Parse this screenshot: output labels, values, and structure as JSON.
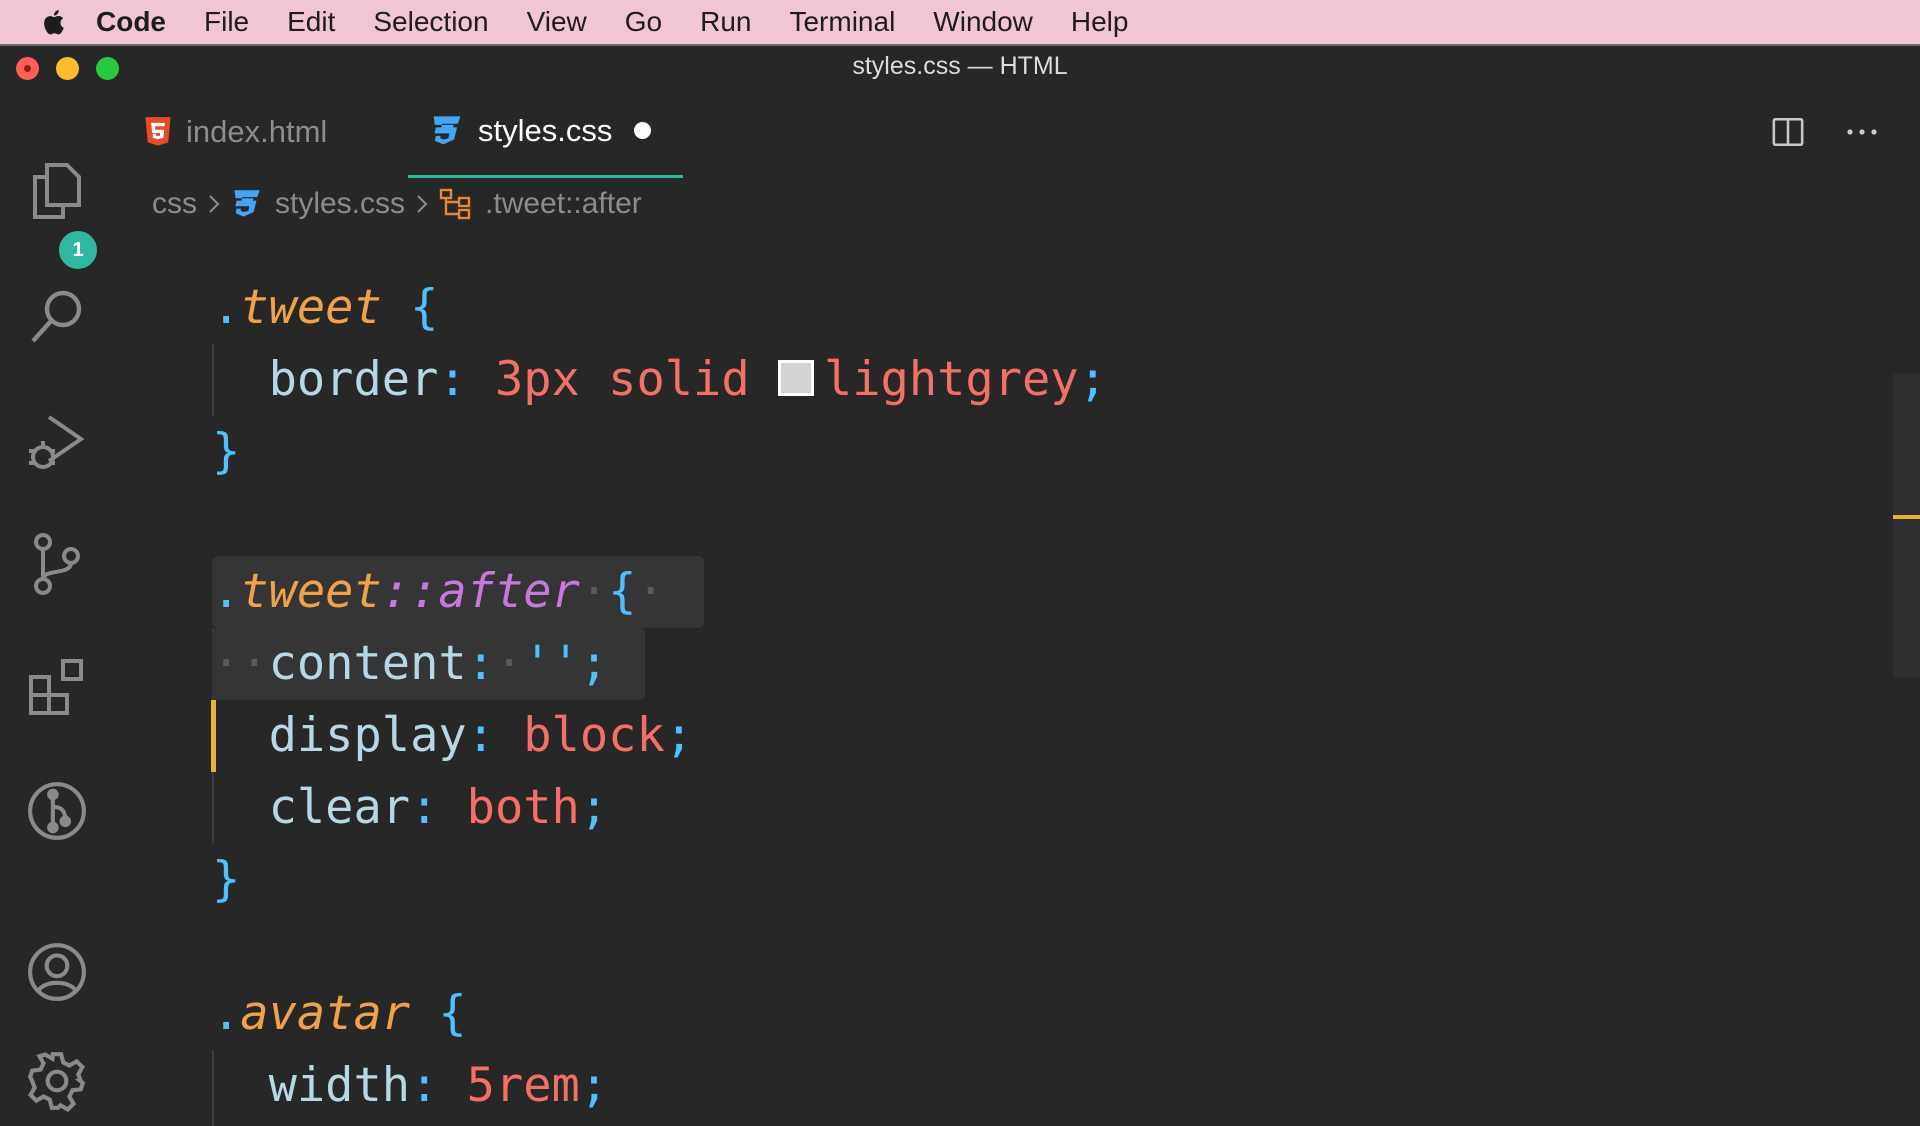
{
  "menubar": {
    "app_name": "Code",
    "items": [
      "File",
      "Edit",
      "Selection",
      "View",
      "Go",
      "Run",
      "Terminal",
      "Window",
      "Help"
    ]
  },
  "window": {
    "title": "styles.css — HTML"
  },
  "activity_bar": {
    "icons": [
      "explorer-icon",
      "search-icon",
      "run-debug-icon",
      "source-control-icon",
      "extensions-icon",
      "git-graph-icon",
      "accounts-icon",
      "settings-gear-icon"
    ],
    "explorer_badge": "1"
  },
  "tabs": [
    {
      "label": "index.html",
      "icon": "html5-icon",
      "active": false
    },
    {
      "label": "styles.css",
      "icon": "css3-icon",
      "active": true,
      "dirty": true
    }
  ],
  "breadcrumbs": {
    "folder": "css",
    "file": "styles.css",
    "symbol": ".tweet::after"
  },
  "code": {
    "rule1_selector": "tweet",
    "rule1_prop": "border",
    "rule1_value_a": "3px solid ",
    "rule1_value_b": "lightgrey",
    "rule2_selector": "tweet",
    "rule2_pseudo": "::after",
    "rule2_l1_prop": "content",
    "rule2_l1_value": "''",
    "rule2_l2_prop": "display",
    "rule2_l2_value": "block",
    "rule2_l3_prop": "clear",
    "rule2_l3_value": "both",
    "rule3_selector": "avatar",
    "rule3_prop": "width",
    "rule3_value": "5rem"
  },
  "colors": {
    "accent": "#30b7a0",
    "selector": "#f0a24a",
    "pseudo": "#c778dd",
    "value": "#f47067",
    "modified": "#e2b43c",
    "swatch_lightgrey": "#d3d3d3"
  }
}
